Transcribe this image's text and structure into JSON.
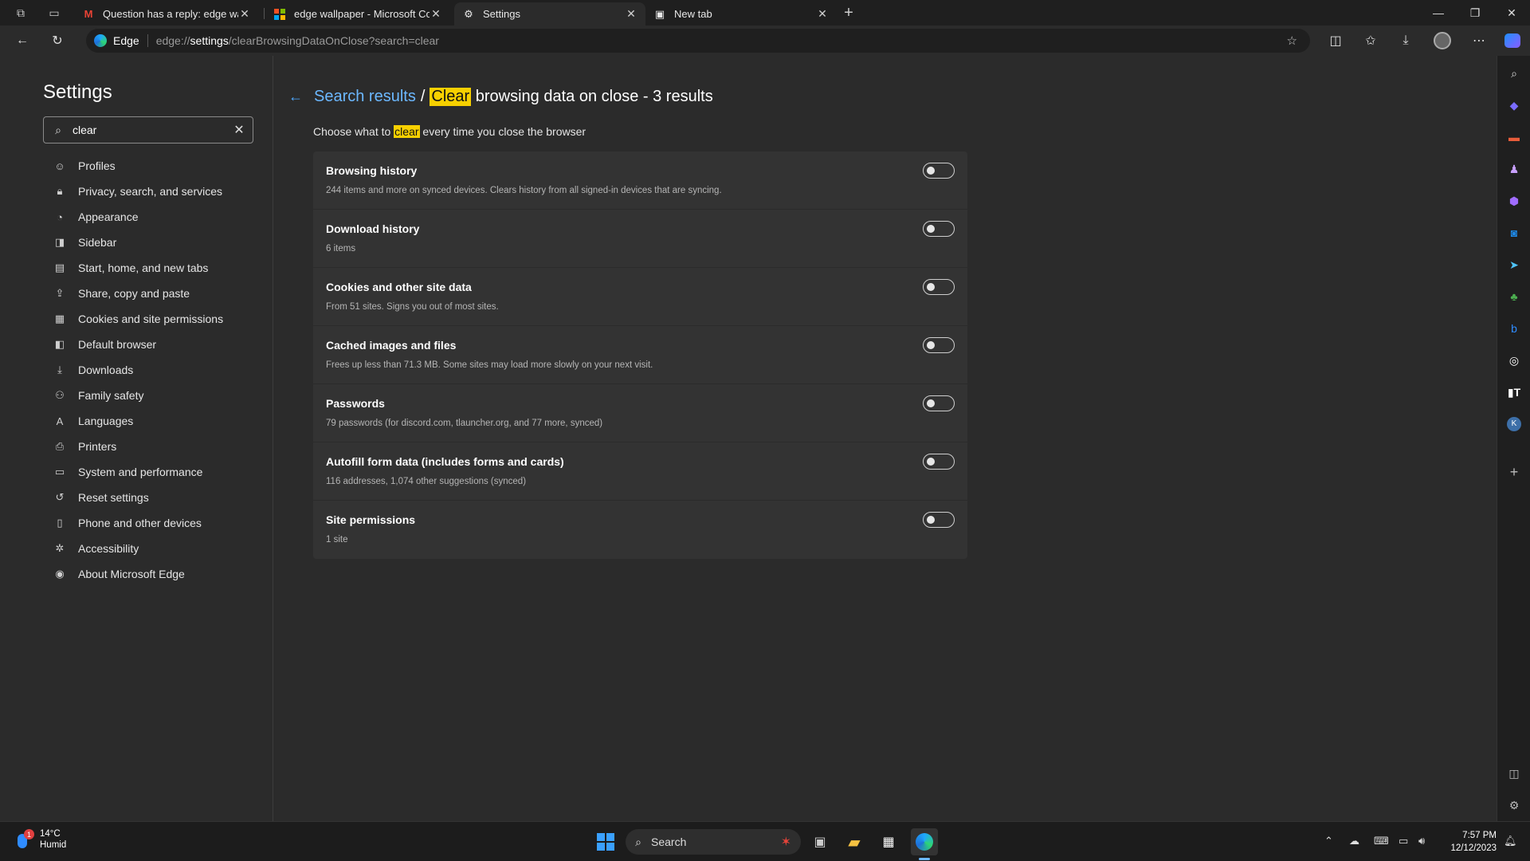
{
  "tabs": [
    {
      "label": "Question has a reply: edge wallp",
      "icon": "gmail-icon",
      "active": false
    },
    {
      "label": "edge wallpaper - Microsoft Com",
      "icon": "microsoft-icon",
      "active": false
    },
    {
      "label": "Settings",
      "icon": "gear-icon",
      "active": true
    },
    {
      "label": "New tab",
      "icon": "newtab-icon",
      "active": false
    }
  ],
  "address": {
    "site_label": "Edge",
    "url_prefix": "edge://",
    "url_host": "settings",
    "url_rest": "/clearBrowsingDataOnClose?search=clear"
  },
  "settings": {
    "title": "Settings",
    "search_value": "clear",
    "nav": [
      {
        "label": "Profiles",
        "icon": "profile-icon"
      },
      {
        "label": "Privacy, search, and services",
        "icon": "lock-icon"
      },
      {
        "label": "Appearance",
        "icon": "appearance-icon"
      },
      {
        "label": "Sidebar",
        "icon": "sidebar-icon"
      },
      {
        "label": "Start, home, and new tabs",
        "icon": "home-icon"
      },
      {
        "label": "Share, copy and paste",
        "icon": "share-icon"
      },
      {
        "label": "Cookies and site permissions",
        "icon": "cookie-icon"
      },
      {
        "label": "Default browser",
        "icon": "browser-icon"
      },
      {
        "label": "Downloads",
        "icon": "download-icon"
      },
      {
        "label": "Family safety",
        "icon": "family-icon"
      },
      {
        "label": "Languages",
        "icon": "language-icon"
      },
      {
        "label": "Printers",
        "icon": "printer-icon"
      },
      {
        "label": "System and performance",
        "icon": "system-icon"
      },
      {
        "label": "Reset settings",
        "icon": "reset-icon"
      },
      {
        "label": "Phone and other devices",
        "icon": "phone-icon"
      },
      {
        "label": "Accessibility",
        "icon": "accessibility-icon"
      },
      {
        "label": "About Microsoft Edge",
        "icon": "edge-icon"
      }
    ]
  },
  "content": {
    "crumb_link": "Search results",
    "crumb_sep": "/",
    "crumb_highlight": "Clear",
    "crumb_rest": " browsing data on close - 3 results",
    "subtitle_pre": "Choose what to ",
    "subtitle_hl": "clear",
    "subtitle_post": " every time you close the browser",
    "rows": [
      {
        "title": "Browsing history",
        "desc": "244 items and more on synced devices. Clears history from all signed-in devices that are syncing.",
        "on": false
      },
      {
        "title": "Download history",
        "desc": "6 items",
        "on": false
      },
      {
        "title": "Cookies and other site data",
        "desc": "From 51 sites. Signs you out of most sites.",
        "on": false
      },
      {
        "title": "Cached images and files",
        "desc": "Frees up less than 71.3 MB. Some sites may load more slowly on your next visit.",
        "on": false
      },
      {
        "title": "Passwords",
        "desc": "79 passwords (for discord.com, tlauncher.org, and 77 more, synced)",
        "on": false
      },
      {
        "title": "Autofill form data (includes forms and cards)",
        "desc": "116 addresses, 1,074 other suggestions (synced)",
        "on": false
      },
      {
        "title": "Site permissions",
        "desc": "1 site",
        "on": false
      }
    ]
  },
  "taskbar": {
    "weather_temp": "14°C",
    "weather_desc": "Humid",
    "weather_badge": "1",
    "search_label": "Search",
    "time": "7:57 PM",
    "date": "12/12/2023"
  },
  "colors": {
    "accent": "#6cb8ff",
    "highlight": "#f7d000"
  }
}
